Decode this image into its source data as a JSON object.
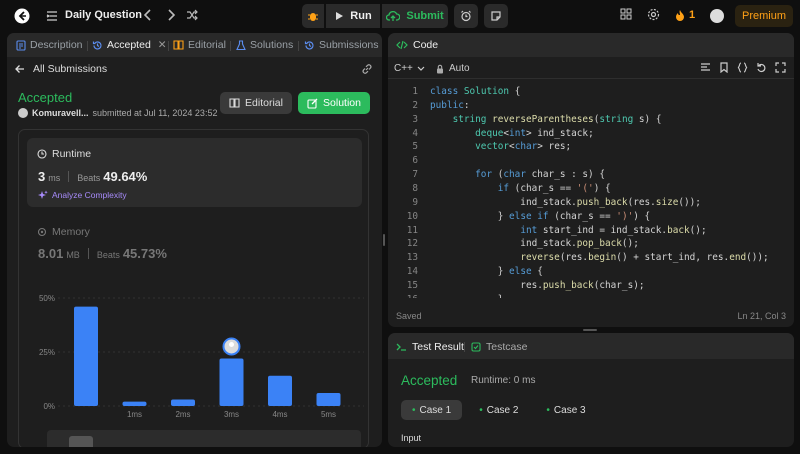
{
  "topbar": {
    "problem_list_label": "Daily Question",
    "run_label": "Run",
    "submit_label": "Submit",
    "streak_count": "1",
    "premium_label": "Premium"
  },
  "left_tabs": {
    "description": "Description",
    "accepted": "Accepted",
    "editorial": "Editorial",
    "solutions": "Solutions",
    "submissions": "Submissions"
  },
  "submission": {
    "back_label": "All Submissions",
    "status": "Accepted",
    "user": "Komuravell...",
    "submitted_text": "submitted at Jul 11, 2024 23:52",
    "editorial_button": "Editorial",
    "solution_button": "Solution"
  },
  "runtime": {
    "title": "Runtime",
    "value": "3",
    "unit": "ms",
    "beats_label": "Beats",
    "beats_value": "49.64%",
    "analyze_label": "Analyze Complexity"
  },
  "memory": {
    "title": "Memory",
    "value": "8.01",
    "unit": "MB",
    "beats_label": "Beats",
    "beats_value": "45.73%"
  },
  "chart_data": {
    "type": "bar",
    "categories": [
      "",
      "1ms",
      "2ms",
      "3ms",
      "4ms",
      "5ms"
    ],
    "values": [
      46,
      2,
      3,
      22,
      14,
      6
    ],
    "y_ticks": [
      "50%",
      "25%",
      "0%"
    ],
    "ylim": [
      0,
      50
    ],
    "highlight_index": 3,
    "bar_color": "#3b82f6"
  },
  "editor": {
    "title": "Code",
    "language": "C++",
    "mode": "Auto",
    "status": "Saved",
    "cursor": "Ln 21, Col 3",
    "lines": [
      "class Solution {",
      "public:",
      "    string reverseParentheses(string s) {",
      "        deque<int> ind_stack;",
      "        vector<char> res;",
      "",
      "        for (char char_s : s) {",
      "            if (char_s == '(') {",
      "                ind_stack.push_back(res.size());",
      "            } else if (char_s == ')') {",
      "                int start_ind = ind_stack.back();",
      "                ind_stack.pop_back();",
      "                reverse(res.begin() + start_ind, res.end());",
      "            } else {",
      "                res.push_back(char_s);",
      "            }"
    ]
  },
  "test": {
    "result_tab": "Test Result",
    "testcase_tab": "Testcase",
    "status": "Accepted",
    "runtime": "Runtime: 0 ms",
    "cases": [
      "Case 1",
      "Case 2",
      "Case 3"
    ],
    "input_label": "Input"
  },
  "colors": {
    "accent_green": "#2cbb5d",
    "accent_orange": "#ffa116",
    "bar_blue": "#3b82f6"
  }
}
